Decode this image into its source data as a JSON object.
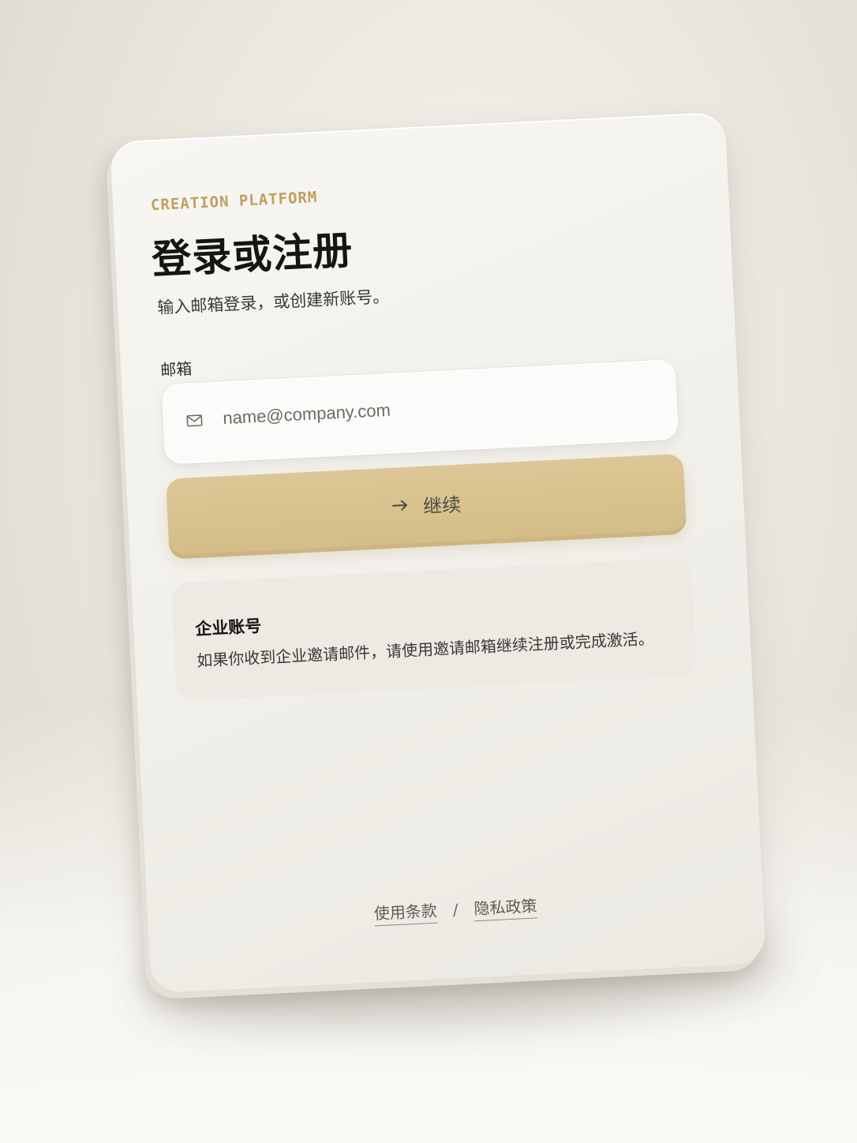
{
  "brand": {
    "eyebrow": "CREATION PLATFORM",
    "accent_color": "#bf9f60"
  },
  "login": {
    "title": "登录或注册",
    "subtitle": "输入邮箱登录，或创建新账号。",
    "email": {
      "label": "邮箱",
      "placeholder": "name@company.com",
      "value": "",
      "icon": "mail-icon"
    },
    "continue": {
      "label": "继续",
      "icon": "arrow-right-icon",
      "color": "#d8c28f"
    }
  },
  "enterprise": {
    "title": "企业账号",
    "body": "如果你收到企业邀请邮件，请使用邀请邮箱继续注册或完成激活。"
  },
  "footer": {
    "terms": "使用条款",
    "separator": "/",
    "privacy": "隐私政策"
  }
}
